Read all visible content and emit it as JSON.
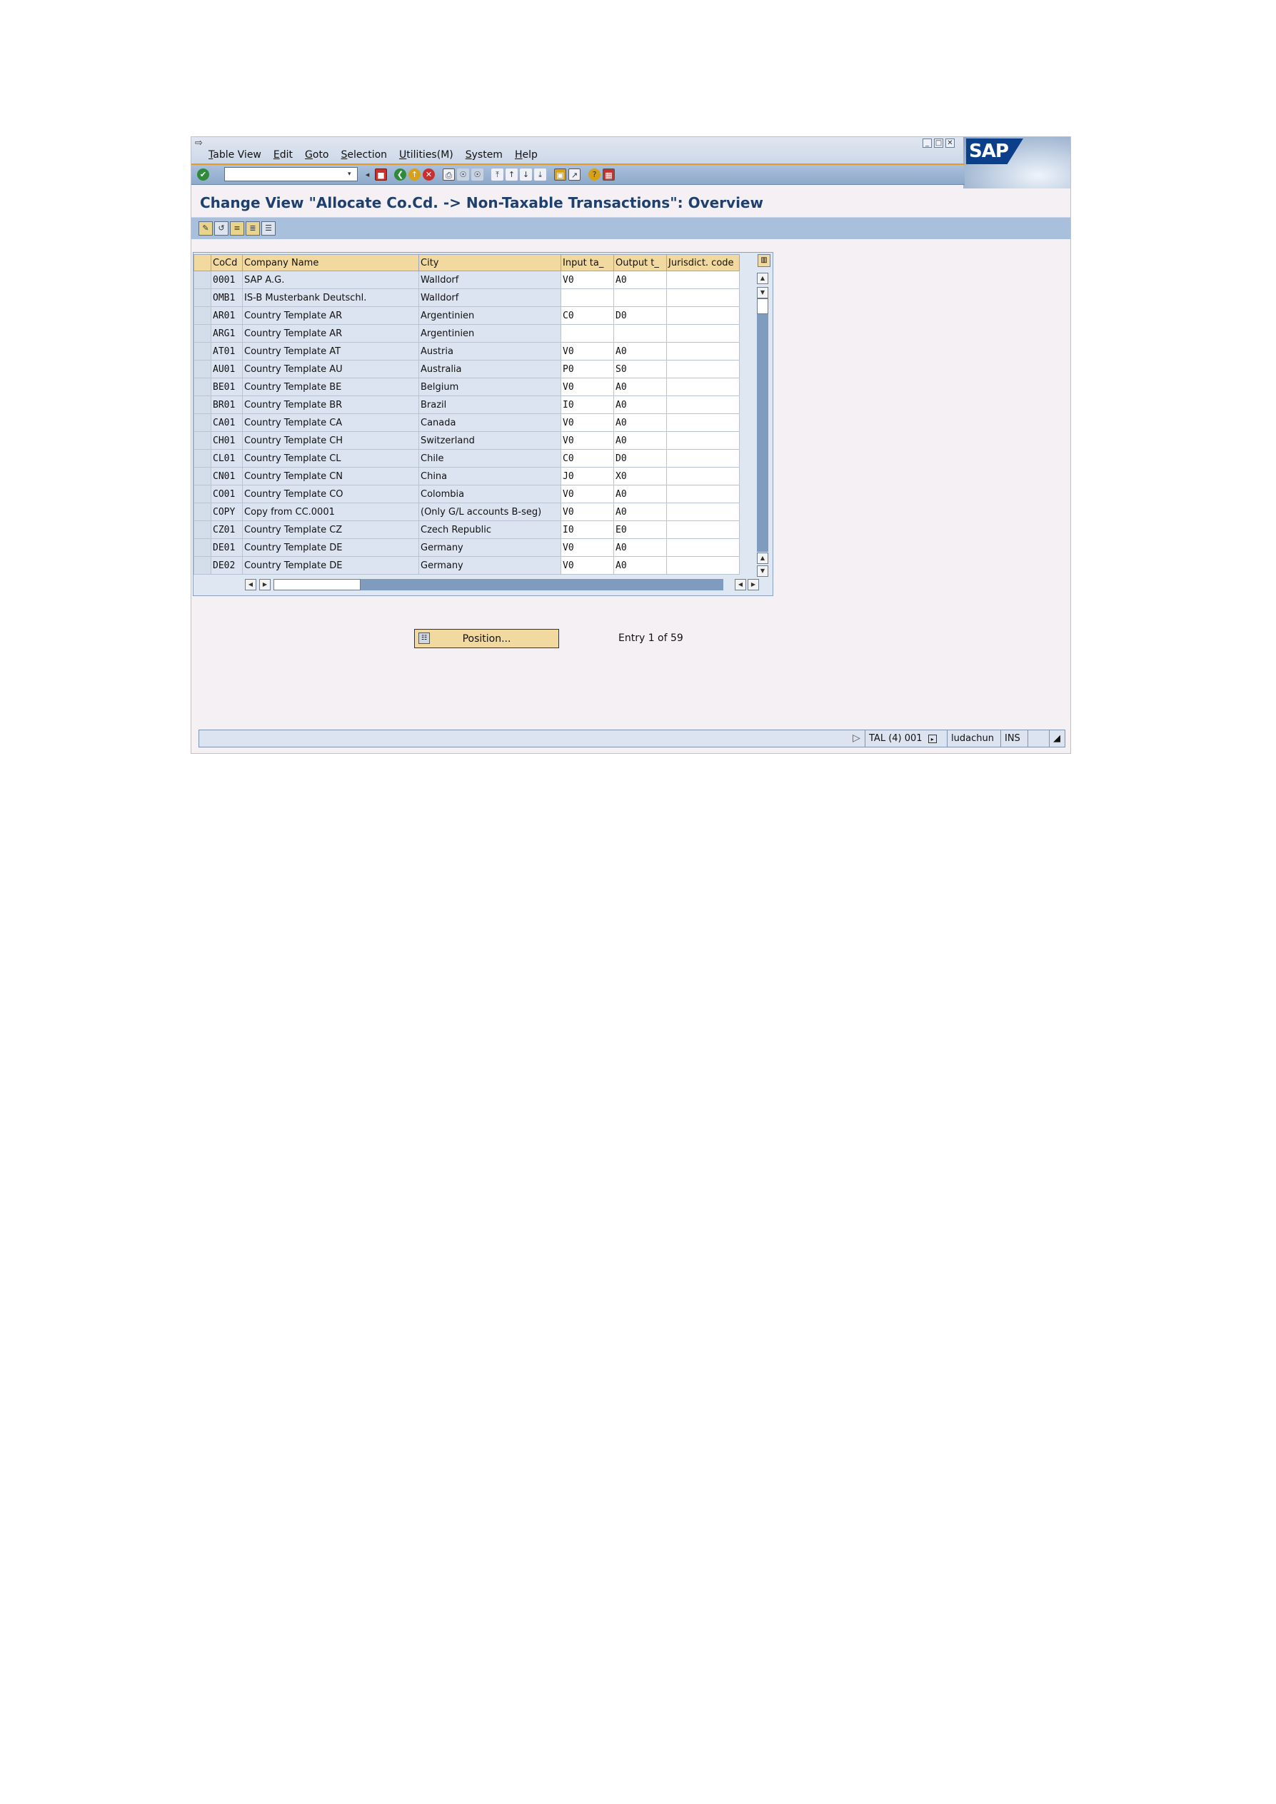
{
  "menu": [
    "Table View",
    "Edit",
    "Goto",
    "Selection",
    "Utilities(M)",
    "System",
    "Help"
  ],
  "logo": "SAP",
  "title": "Change View \"Allocate Co.Cd. -> Non-Taxable Transactions\": Overview",
  "table": {
    "headers": [
      "CoCd",
      "Company Name",
      "City",
      "Input ta_",
      "Output t_",
      "Jurisdict. code"
    ],
    "rows": [
      [
        "0001",
        "SAP A.G.",
        "Walldorf",
        "V0",
        "A0",
        ""
      ],
      [
        "OMB1",
        "IS-B Musterbank Deutschl.",
        "Walldorf",
        "",
        "",
        ""
      ],
      [
        "AR01",
        "Country Template AR",
        "Argentinien",
        "C0",
        "D0",
        ""
      ],
      [
        "ARG1",
        "Country Template AR",
        "Argentinien",
        "",
        "",
        ""
      ],
      [
        "AT01",
        "Country Template AT",
        "Austria",
        "V0",
        "A0",
        ""
      ],
      [
        "AU01",
        "Country Template AU",
        "Australia",
        "P0",
        "S0",
        ""
      ],
      [
        "BE01",
        "Country Template BE",
        "Belgium",
        "V0",
        "A0",
        ""
      ],
      [
        "BR01",
        "Country Template BR",
        "Brazil",
        "I0",
        "A0",
        ""
      ],
      [
        "CA01",
        "Country Template CA",
        "Canada",
        "V0",
        "A0",
        ""
      ],
      [
        "CH01",
        "Country Template CH",
        "Switzerland",
        "V0",
        "A0",
        ""
      ],
      [
        "CL01",
        "Country Template CL",
        "Chile",
        "C0",
        "D0",
        ""
      ],
      [
        "CN01",
        "Country Template CN",
        "China",
        "J0",
        "X0",
        ""
      ],
      [
        "CO01",
        "Country Template CO",
        "Colombia",
        "V0",
        "A0",
        ""
      ],
      [
        "COPY",
        "Copy from CC.0001",
        "(Only G/L accounts B-seg)",
        "V0",
        "A0",
        ""
      ],
      [
        "CZ01",
        "Country Template CZ",
        "Czech Republic",
        "I0",
        "E0",
        ""
      ],
      [
        "DE01",
        "Country Template DE",
        "Germany",
        "V0",
        "A0",
        ""
      ],
      [
        "DE02",
        "Country Template DE",
        "Germany",
        "V0",
        "A0",
        ""
      ]
    ]
  },
  "position_button": "Position...",
  "entry_info": "Entry 1 of 59",
  "status": {
    "system": "TAL (4) 001",
    "user": "ludachun",
    "mode": "INS"
  }
}
